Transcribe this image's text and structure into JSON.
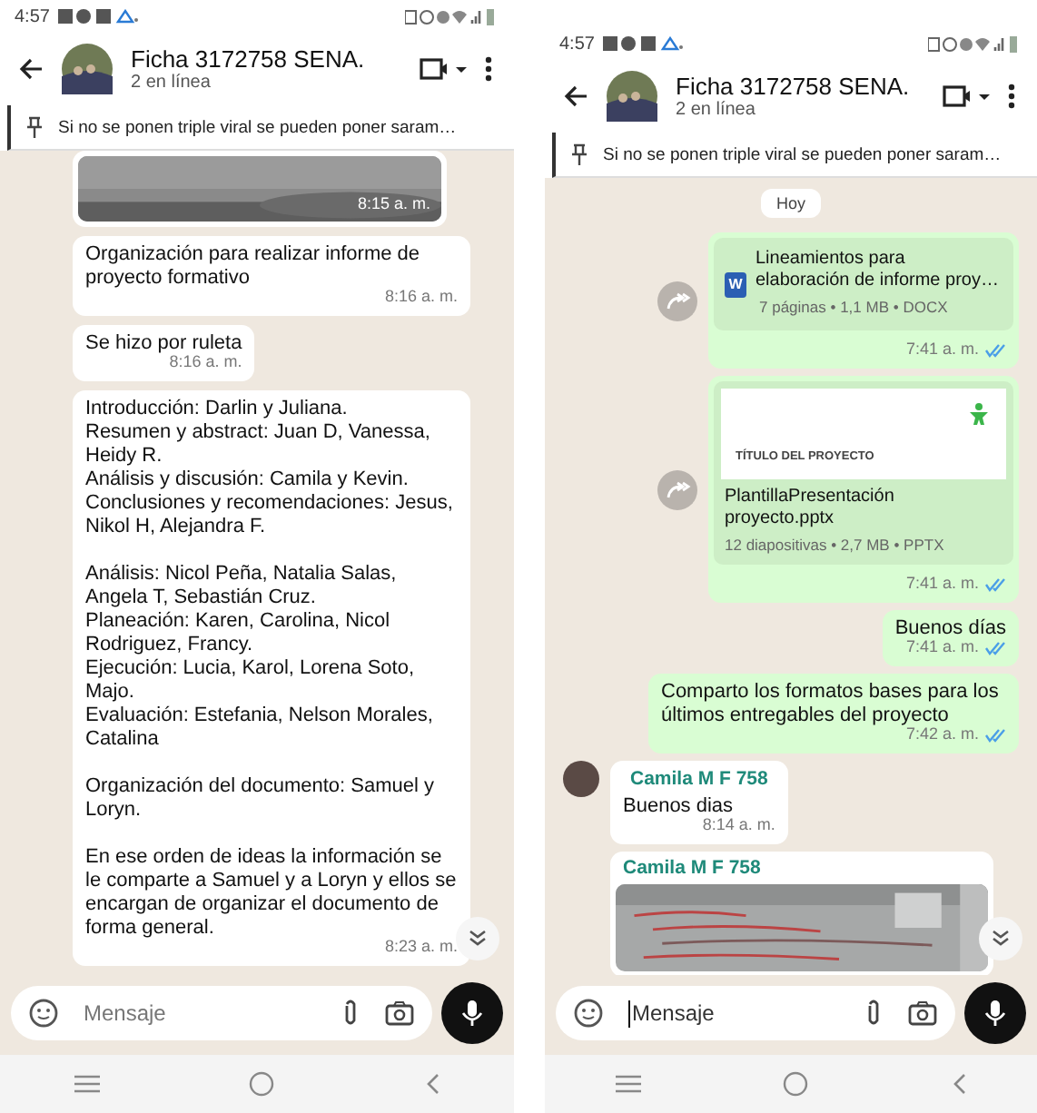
{
  "phones": [
    {
      "status_bar": {
        "time": "4:57"
      },
      "header": {
        "title": "Ficha 3172758 SENA.",
        "subtitle": "2 en línea"
      },
      "pinned": {
        "text": "Si no se ponen triple viral se pueden poner saram…"
      },
      "messages": [
        {
          "outgoing": false,
          "time": "8:15 a. m."
        },
        {
          "kind": "text",
          "outgoing": false,
          "text": "Organización para realizar informe de proyecto formativo",
          "time": "8:16 a. m."
        },
        {
          "kind": "text",
          "outgoing": false,
          "text": "Se hizo por ruleta",
          "time": "8:16 a. m."
        },
        {
          "kind": "text",
          "outgoing": false,
          "text": "Introducción: Darlin y Juliana.\nResumen y abstract: Juan D, Vanessa, Heidy R.\nAnálisis y discusión: Camila y Kevin.\nConclusiones y recomendaciones: Jesus, Nikol H, Alejandra F.\n\nAnálisis: Nicol Peña, Natalia Salas, Angela T, Sebastián Cruz.\nPlaneación: Karen, Carolina, Nicol Rodriguez, Francy.\nEjecución: Lucia, Karol, Lorena Soto, Majo.\nEvaluación: Estefania, Nelson Morales, Catalina\n\nOrganización del documento: Samuel y Loryn.\n\nEn ese orden de ideas la información se le comparte a Samuel y a Loryn y ellos se encargan de organizar el documento de forma general.",
          "time": "8:23 a. m."
        }
      ],
      "composer": {
        "placeholder": "Mensaje",
        "focused": false
      }
    },
    {
      "status_bar": {
        "time": "4:57"
      },
      "header": {
        "title": "Ficha 3172758 SENA.",
        "subtitle": "2 en línea"
      },
      "pinned": {
        "text": "Si no se ponen triple viral se pueden poner saram…"
      },
      "messages": [
        {
          "kind": "date",
          "text": "Hoy"
        },
        {
          "kind": "document",
          "outgoing": true,
          "icon_letter": "W",
          "file_name": "Lineamientos para elaboración de informe proy…",
          "meta": "7 páginas • 1,1 MB • DOCX",
          "time": "7:41 a. m.",
          "read": true
        },
        {
          "kind": "presentation",
          "outgoing": true,
          "preview_title": "TÍTULO DEL PROYECTO",
          "file_name": "PlantillaPresentación proyecto.pptx",
          "meta": "12 diapositivas • 2,7 MB • PPTX",
          "time": "7:41 a. m.",
          "read": true
        },
        {
          "kind": "text",
          "outgoing": true,
          "text": "Buenos días",
          "time": "7:41 a. m.",
          "read": true
        },
        {
          "kind": "text",
          "outgoing": true,
          "text": "Comparto los formatos bases para los últimos entregables del proyecto",
          "time": "7:42 a. m.",
          "read": true
        },
        {
          "kind": "text",
          "outgoing": false,
          "avatar": true,
          "sender": "Camila M F 758",
          "text": "Buenos dias",
          "time": "8:14 a. m."
        },
        {
          "outgoing": false,
          "sender": "Camila M F 758"
        }
      ],
      "composer": {
        "placeholder": "Mensaje",
        "focused": true
      }
    }
  ]
}
